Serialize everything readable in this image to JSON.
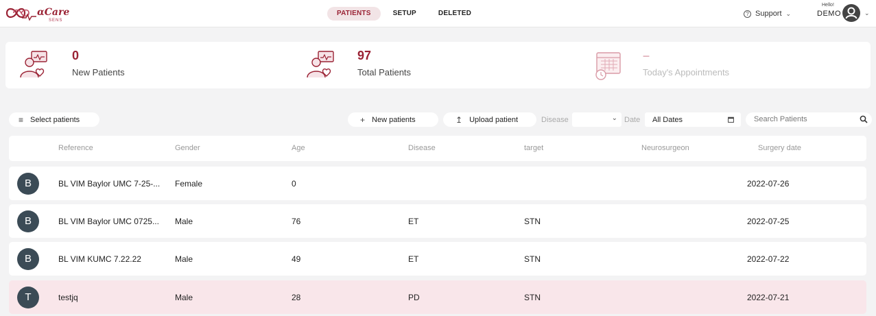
{
  "app": {
    "logo_text": "αCare",
    "logo_sub": "SENS"
  },
  "nav": {
    "tabs": [
      {
        "label": "PATIENTS",
        "active": true
      },
      {
        "label": "SETUP",
        "active": false
      },
      {
        "label": "DELETED",
        "active": false
      }
    ]
  },
  "header": {
    "support_label": "Support",
    "greeting": "Hello!",
    "user_name": "DEMO"
  },
  "stats": [
    {
      "value": "0",
      "label": "New Patients",
      "icon": "patient-heart-icon"
    },
    {
      "value": "97",
      "label": "Total Patients",
      "icon": "patient-heart-icon"
    },
    {
      "value": "–",
      "label": "Today's Appointments",
      "icon": "calendar-clock-icon"
    }
  ],
  "toolbar": {
    "select_patients": "Select patients",
    "new_patients": "New patients",
    "upload_patient": "Upload patient",
    "disease_label": "Disease",
    "disease_value": "",
    "date_label": "Date",
    "date_value": "All Dates",
    "search_placeholder": "Search Patients"
  },
  "table": {
    "columns": [
      "Reference",
      "Gender",
      "Age",
      "Disease",
      "target",
      "Neurosurgeon",
      "Surgery date"
    ],
    "rows": [
      {
        "initial": "B",
        "reference": "BL VIM Baylor UMC 7-25-...",
        "gender": "Female",
        "age": "0",
        "disease": "",
        "target": "",
        "neurosurgeon": "",
        "surgery_date": "2022-07-26",
        "selected": false
      },
      {
        "initial": "B",
        "reference": "BL VIM Baylor UMC 0725...",
        "gender": "Male",
        "age": "76",
        "disease": "ET",
        "target": "STN",
        "neurosurgeon": "",
        "surgery_date": "2022-07-25",
        "selected": false
      },
      {
        "initial": "B",
        "reference": "BL VIM KUMC 7.22.22",
        "gender": "Male",
        "age": "49",
        "disease": "ET",
        "target": "STN",
        "neurosurgeon": "",
        "surgery_date": "2022-07-22",
        "selected": false
      },
      {
        "initial": "T",
        "reference": "testjq",
        "gender": "Male",
        "age": "28",
        "disease": "PD",
        "target": "STN",
        "neurosurgeon": "",
        "surgery_date": "2022-07-21",
        "selected": true
      }
    ]
  },
  "colors": {
    "accent": "#9a2234",
    "selected_row": "#f9e6ea",
    "avatar": "#3b4b56"
  }
}
